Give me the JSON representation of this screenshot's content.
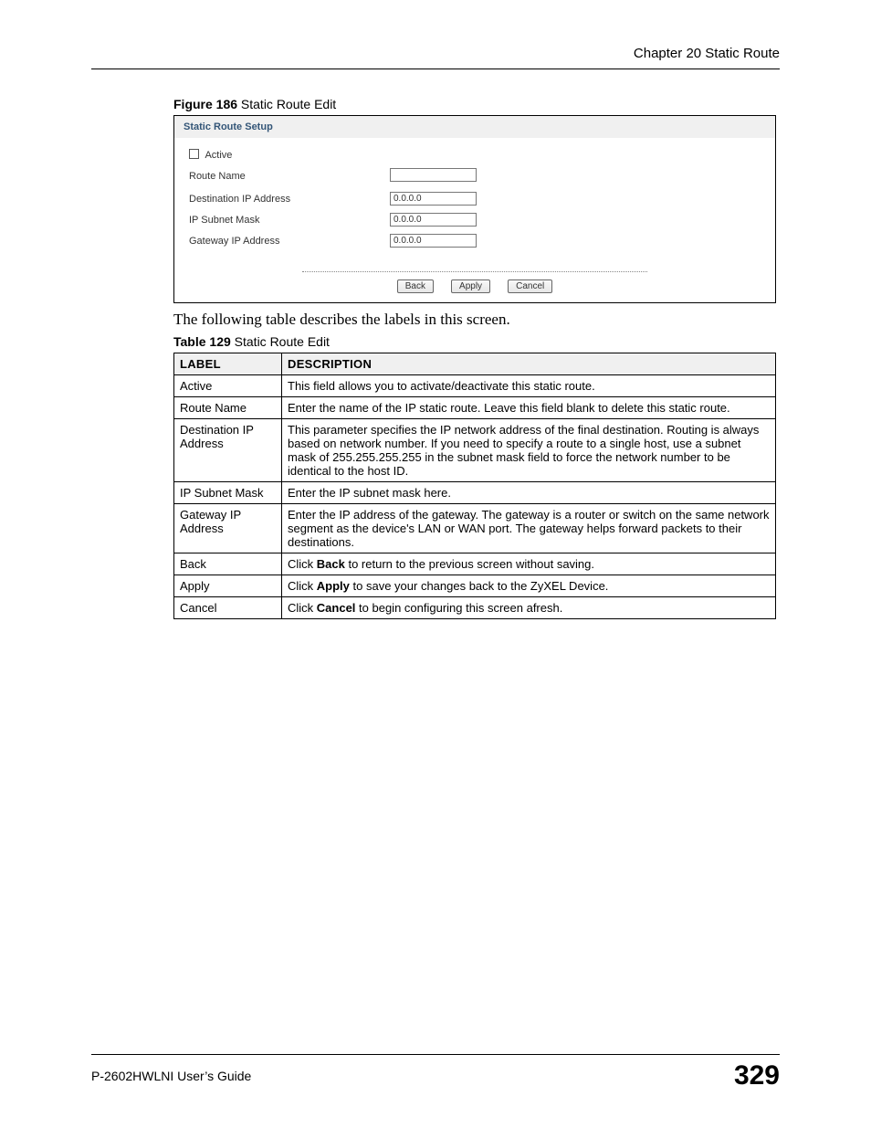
{
  "header": {
    "chapter": "Chapter 20 Static Route"
  },
  "figure": {
    "caption_bold": "Figure 186",
    "caption_rest": "   Static Route Edit",
    "panel_title": "Static Route Setup",
    "fields": {
      "active_label": "Active",
      "route_name_label": "Route Name",
      "route_name_value": "",
      "dest_ip_label": "Destination IP Address",
      "dest_ip_value": "0.0.0.0",
      "subnet_label": "IP Subnet Mask",
      "subnet_value": "0.0.0.0",
      "gateway_label": "Gateway IP Address",
      "gateway_value": "0.0.0.0"
    },
    "buttons": {
      "back": "Back",
      "apply": "Apply",
      "cancel": "Cancel"
    }
  },
  "paragraph": "The following table describes the labels in this screen.",
  "table": {
    "caption_bold": "Table 129",
    "caption_rest": "   Static Route Edit",
    "head_label": "LABEL",
    "head_desc": "DESCRIPTION",
    "rows": {
      "r0_label": "Active",
      "r0_desc": "This field allows you to activate/deactivate this static route.",
      "r1_label": "Route Name",
      "r1_desc": "Enter the name of the IP static route. Leave this field blank to delete this static route.",
      "r2_label": "Destination IP Address",
      "r2_desc": "This parameter specifies the IP network address of the final destination.  Routing is always based on network number. If you need to specify a route to a single host, use a subnet mask of 255.255.255.255 in the subnet mask field to force the network number to be identical to the host ID.",
      "r3_label": "IP Subnet Mask",
      "r3_desc": "Enter the IP subnet mask here.",
      "r4_label": "Gateway IP Address",
      "r4_desc": "Enter the IP address of the gateway. The gateway is a router or switch on the same network segment as the device's LAN or WAN port. The gateway helps forward packets to their destinations.",
      "r5_label": "Back",
      "r5_desc_pre": "Click ",
      "r5_desc_bold": "Back",
      "r5_desc_post": " to return to the previous screen without saving.",
      "r6_label": "Apply",
      "r6_desc_pre": "Click ",
      "r6_desc_bold": "Apply",
      "r6_desc_post": " to save your changes back to the ZyXEL Device.",
      "r7_label": "Cancel",
      "r7_desc_pre": "Click ",
      "r7_desc_bold": "Cancel",
      "r7_desc_post": " to begin configuring this screen afresh."
    }
  },
  "footer": {
    "guide": "P-2602HWLNI User’s Guide",
    "page": "329"
  }
}
